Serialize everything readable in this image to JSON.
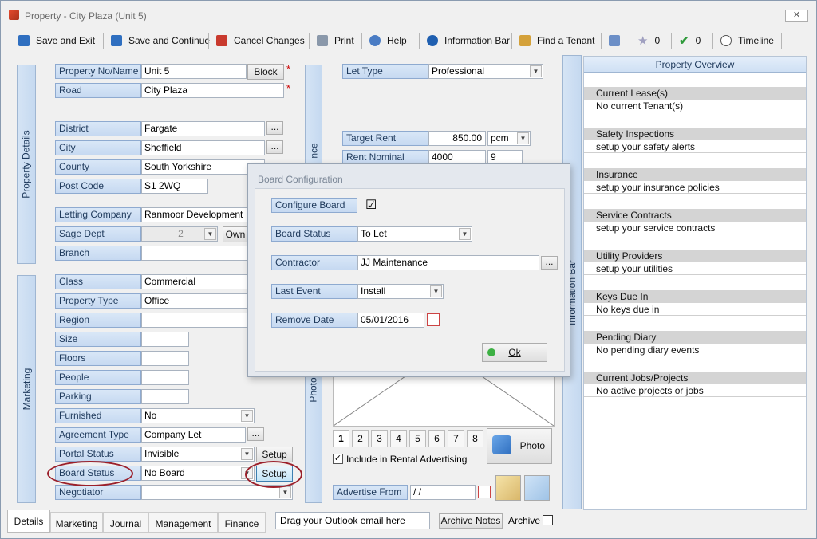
{
  "window": {
    "title": "Property  - City Plaza (Unit 5)",
    "close": "✕"
  },
  "toolbar": {
    "items": [
      {
        "label": "Save and Exit",
        "icon": "save-exit-icon"
      },
      {
        "label": "Save and Continue",
        "icon": "save-continue-icon"
      },
      {
        "label": "Cancel Changes",
        "icon": "cancel-icon"
      },
      {
        "label": "Print",
        "icon": "print-icon"
      },
      {
        "label": "Help",
        "icon": "help-icon"
      },
      {
        "label": "Information Bar",
        "icon": "info-icon"
      },
      {
        "label": "Find a Tenant",
        "icon": "find-tenant-icon"
      },
      {
        "label": "",
        "icon": "document-icon"
      },
      {
        "label": "0",
        "icon": "star-icon"
      },
      {
        "label": "0",
        "icon": "check-icon"
      },
      {
        "label": "Timeline",
        "icon": "timeline-icon"
      }
    ]
  },
  "side_tabs": {
    "property_details": "Property Details",
    "marketing": "Marketing",
    "finance_partial": "nce",
    "photo_partial": "Photo",
    "information_bar": "Information Bar"
  },
  "form": {
    "property_no_label": "Property No/Name",
    "property_no": "Unit 5",
    "block_button": "Block",
    "road_label": "Road",
    "road": "City Plaza",
    "district_label": "District",
    "district": "Fargate",
    "city_label": "City",
    "city": "Sheffield",
    "county_label": "County",
    "county": "South Yorkshire",
    "postcode_label": "Post Code",
    "postcode": "S1 2WQ",
    "letting_company_label": "Letting Company",
    "letting_company": "Ranmoor Development",
    "sage_dept_label": "Sage Dept",
    "sage_dept": "2",
    "own_button": "Own",
    "branch_label": "Branch",
    "branch": "",
    "class_label": "Class",
    "class": "Commercial",
    "property_type_label": "Property Type",
    "property_type": "Office",
    "region_label": "Region",
    "size_label": "Size",
    "floors_label": "Floors",
    "people_label": "People",
    "parking_label": "Parking",
    "furnished_label": "Furnished",
    "furnished": "No",
    "agreement_type_label": "Agreement Type",
    "agreement_type": "Company Let",
    "portal_status_label": "Portal Status",
    "portal_status": "Invisible",
    "setup_button": "Setup",
    "board_status_label": "Board Status",
    "board_status": "No Board",
    "negotiator_label": "Negotiator",
    "negotiator": "",
    "ellipsis": "...",
    "required": "*"
  },
  "right_form": {
    "let_type_label": "Let Type",
    "let_type": "Professional",
    "target_rent_label": "Target Rent",
    "target_rent": "850.00",
    "target_rent_unit": "pcm",
    "rent_nominal_label": "Rent Nominal",
    "rent_nominal": "4000",
    "rent_nominal_2": "9",
    "photo_pages": [
      "1",
      "2",
      "3",
      "4",
      "5",
      "6",
      "7",
      "8"
    ],
    "photo_button": "Photo",
    "include_rental_label": "Include in  Rental Advertising",
    "advertise_from_label": "Advertise From",
    "advertise_from": " / /"
  },
  "dialog": {
    "title": "Board Configuration",
    "configure_board_label": "Configure Board",
    "configure_board_checked": "☑",
    "board_status_label": "Board Status",
    "board_status": "To Let",
    "contractor_label": "Contractor",
    "contractor": "JJ Maintenance",
    "last_event_label": "Last Event",
    "last_event": "Install",
    "remove_date_label": "Remove Date",
    "remove_date": "05/01/2016",
    "ok_button": "Ok"
  },
  "overview": {
    "title": "Property Overview",
    "sections": [
      {
        "header": "Current Lease(s)",
        "value": "No current Tenant(s)"
      },
      {
        "header": "Safety Inspections",
        "value": "setup your safety alerts"
      },
      {
        "header": "Insurance",
        "value": "setup your insurance policies"
      },
      {
        "header": "Service Contracts",
        "value": "setup your service contracts"
      },
      {
        "header": "Utility Providers",
        "value": "setup your utilities"
      },
      {
        "header": "Keys Due In",
        "value": "No keys due in"
      },
      {
        "header": "Pending Diary",
        "value": "No pending diary events"
      },
      {
        "header": "Current Jobs/Projects",
        "value": "No active projects or jobs"
      }
    ]
  },
  "bottom": {
    "tabs": [
      "Details",
      "Marketing",
      "Journal",
      "Management",
      "Finance"
    ],
    "outlook_drop": "Drag your Outlook email here",
    "archive_notes_button": "Archive Notes",
    "archive_label": "Archive"
  },
  "colors": {
    "label_bg": "#c6d9f1",
    "label_text": "#1e395b",
    "annotation_circle": "#9b1f2a"
  }
}
